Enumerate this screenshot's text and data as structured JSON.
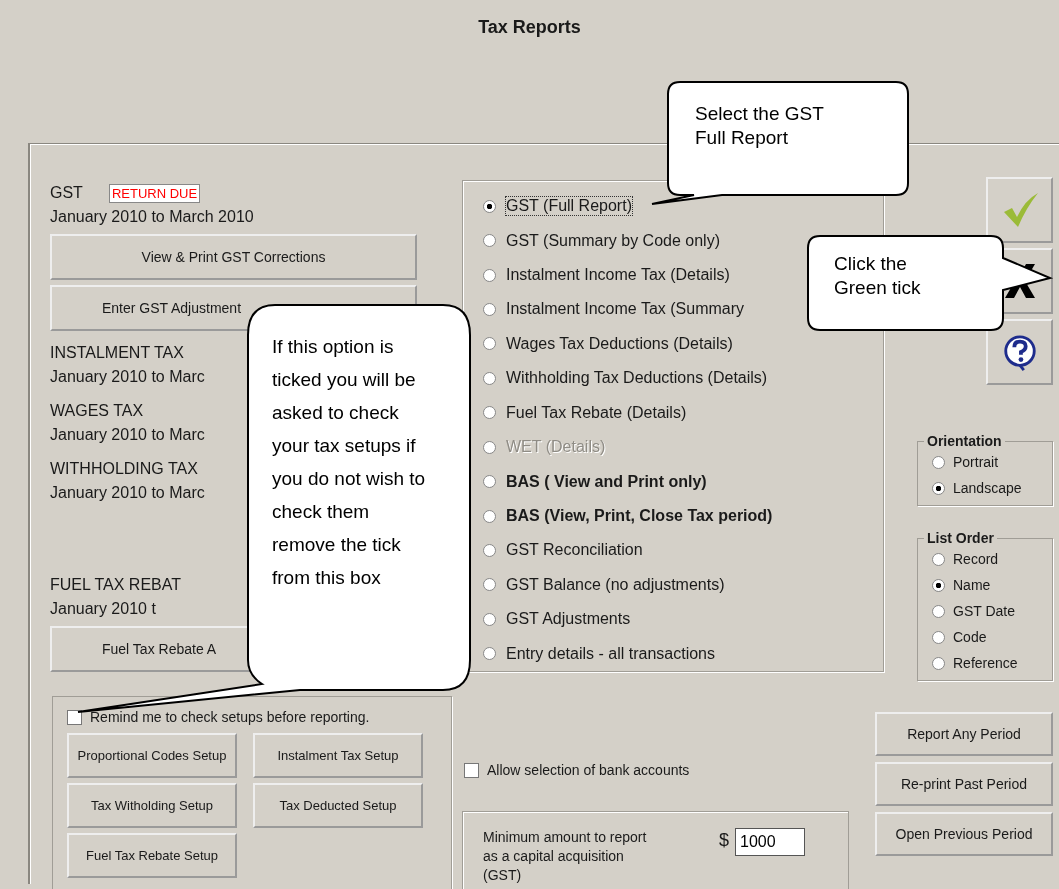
{
  "window": {
    "title": "Tax Reports"
  },
  "tax_periods": [
    {
      "heading": "GST",
      "badge": "RETURN DUE",
      "range": "January 2010 to March 2010",
      "buttons": [
        "View  & Print GST Corrections",
        "Enter GST Adjustment"
      ]
    },
    {
      "heading": "INSTALMENT TAX",
      "range": "January 2010 to Marc"
    },
    {
      "heading": "WAGES TAX",
      "range": "January 2010 to Marc"
    },
    {
      "heading": "WITHHOLDING TAX",
      "range": "January 2010 to Marc"
    },
    {
      "heading": "FUEL TAX REBAT",
      "range": "January 2010 t",
      "buttons": [
        "Fuel Tax Rebate A"
      ]
    }
  ],
  "report_types": [
    {
      "label": "GST (Full Report)",
      "selected": true,
      "disabled": false,
      "bold": false
    },
    {
      "label": "GST (Summary by Code only)",
      "selected": false,
      "disabled": false,
      "bold": false
    },
    {
      "label": "Instalment Income Tax (Details)",
      "selected": false,
      "disabled": false,
      "bold": false
    },
    {
      "label": "Instalment Income Tax (Summary",
      "selected": false,
      "disabled": false,
      "bold": false
    },
    {
      "label": "Wages Tax Deductions (Details)",
      "selected": false,
      "disabled": false,
      "bold": false
    },
    {
      "label": "Withholding Tax Deductions (Details)",
      "selected": false,
      "disabled": false,
      "bold": false
    },
    {
      "label": "Fuel Tax Rebate (Details)",
      "selected": false,
      "disabled": false,
      "bold": false
    },
    {
      "label": "WET (Details)",
      "selected": false,
      "disabled": true,
      "bold": false
    },
    {
      "label": "BAS ( View and Print only)",
      "selected": false,
      "disabled": false,
      "bold": true
    },
    {
      "label": "BAS (View, Print, Close Tax period)",
      "selected": false,
      "disabled": false,
      "bold": true
    },
    {
      "label": "GST Reconciliation",
      "selected": false,
      "disabled": false,
      "bold": false
    },
    {
      "label": "GST Balance (no adjustments)",
      "selected": false,
      "disabled": false,
      "bold": false
    },
    {
      "label": "GST Adjustments",
      "selected": false,
      "disabled": false,
      "bold": false
    },
    {
      "label": "Entry details - all transactions",
      "selected": false,
      "disabled": false,
      "bold": false
    }
  ],
  "action_buttons": [
    {
      "kind": "ok"
    },
    {
      "kind": "cancel"
    },
    {
      "kind": "help"
    }
  ],
  "option_groups": [
    {
      "title": "Orientation",
      "options": [
        {
          "label": "Portrait",
          "selected": false
        },
        {
          "label": "Landscape",
          "selected": true
        }
      ]
    },
    {
      "title": "List Order",
      "options": [
        {
          "label": "Record",
          "selected": false
        },
        {
          "label": "Name",
          "selected": true
        },
        {
          "label": "GST Date",
          "selected": false
        },
        {
          "label": "Code",
          "selected": false
        },
        {
          "label": "Reference",
          "selected": false
        }
      ]
    }
  ],
  "setups": {
    "remind": {
      "label": "Remind me to check setups before reporting.",
      "checked": false
    },
    "buttons": [
      "Proportional Codes Setup",
      "Instalment Tax Setup",
      "Tax Witholding Setup",
      "Tax Deducted Setup",
      "Fuel Tax Rebate Setup"
    ]
  },
  "bank_accounts": {
    "label": "Allow selection of bank accounts",
    "checked": false
  },
  "min_amount": {
    "label": "Minimum amount to report as a capital acquisition (GST)",
    "currency": "$",
    "value": "1000"
  },
  "period_buttons": [
    "Report Any Period",
    "Re-print Past Period",
    "Open Previous Period"
  ],
  "callouts": [
    {
      "text": "Select the GST Full Report"
    },
    {
      "text": "Click the Green tick"
    },
    {
      "text": "If this option is ticked you will be asked to check your tax setups if you do not wish to check them remove the tick from this box"
    }
  ]
}
